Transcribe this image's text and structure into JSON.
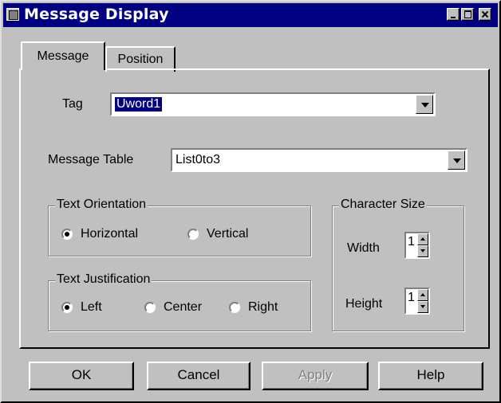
{
  "window": {
    "title": "Message Display"
  },
  "tabs": [
    "Message",
    "Position"
  ],
  "tag": {
    "label": "Tag",
    "value": "Uword1"
  },
  "message_table": {
    "label": "Message Table",
    "value": "List0to3"
  },
  "text_orientation": {
    "legend": "Text Orientation",
    "options": [
      "Horizontal",
      "Vertical"
    ],
    "selected": "Horizontal"
  },
  "text_justification": {
    "legend": "Text Justification",
    "options": [
      "Left",
      "Center",
      "Right"
    ],
    "selected": "Left"
  },
  "character_size": {
    "legend": "Character Size",
    "width_label": "Width",
    "width_value": "1",
    "height_label": "Height",
    "height_value": "1"
  },
  "buttons": {
    "ok": "OK",
    "cancel": "Cancel",
    "apply": "Apply",
    "help": "Help"
  }
}
